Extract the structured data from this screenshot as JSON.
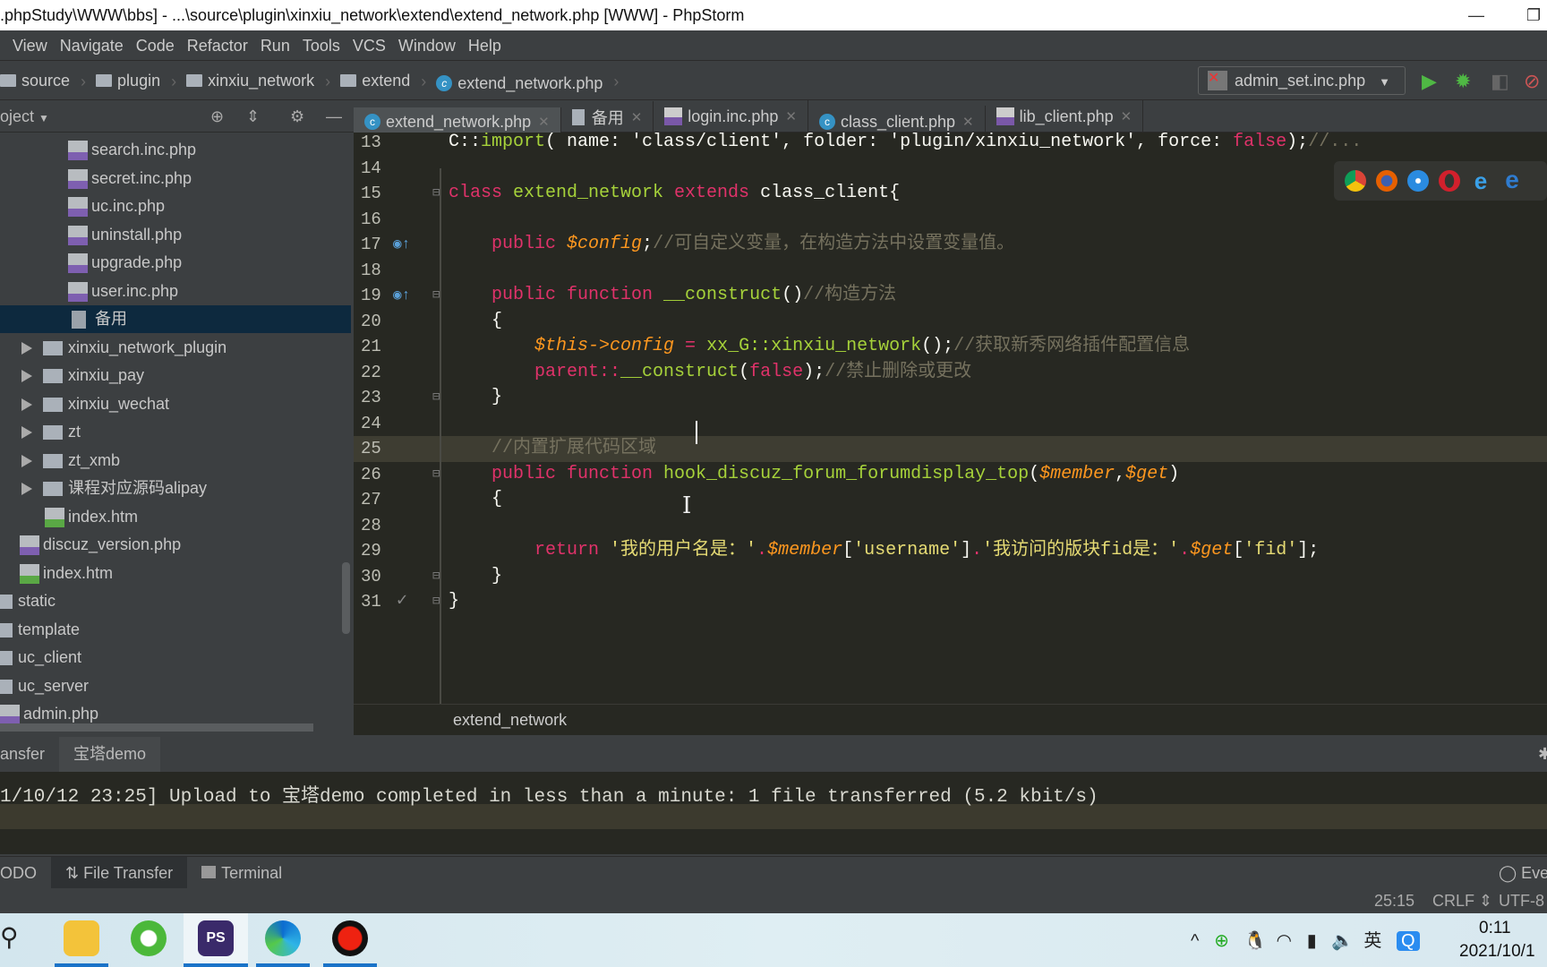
{
  "window": {
    "title": ".phpStudy\\WWW\\bbs] - ...\\source\\plugin\\xinxiu_network\\extend\\extend_network.php [WWW] - PhpStorm",
    "minimize": "—",
    "restore": "❐"
  },
  "menu": [
    "View",
    "Navigate",
    "Code",
    "Refactor",
    "Run",
    "Tools",
    "VCS",
    "Window",
    "Help"
  ],
  "breadcrumb": [
    "source",
    "plugin",
    "xinxiu_network",
    "extend",
    "extend_network.php"
  ],
  "run_config": {
    "label": "admin_set.inc.php"
  },
  "project": {
    "label": "oject"
  },
  "tabs": [
    {
      "label": "extend_network.php",
      "icon": "class",
      "active": true
    },
    {
      "label": "备用",
      "icon": "text"
    },
    {
      "label": "login.inc.php",
      "icon": "php"
    },
    {
      "label": "class_client.php",
      "icon": "class"
    },
    {
      "label": "lib_client.php",
      "icon": "php"
    }
  ],
  "tree": [
    {
      "label": "search.inc.php",
      "type": "php",
      "depth": 3
    },
    {
      "label": "secret.inc.php",
      "type": "php",
      "depth": 3
    },
    {
      "label": "uc.inc.php",
      "type": "php",
      "depth": 3
    },
    {
      "label": "uninstall.php",
      "type": "php",
      "depth": 3
    },
    {
      "label": "upgrade.php",
      "type": "php",
      "depth": 3
    },
    {
      "label": "user.inc.php",
      "type": "php",
      "depth": 3
    },
    {
      "label": "备用",
      "type": "doc",
      "depth": 3,
      "selected": true
    },
    {
      "label": "xinxiu_network_plugin",
      "type": "folder",
      "depth": 2
    },
    {
      "label": "xinxiu_pay",
      "type": "folder",
      "depth": 2
    },
    {
      "label": "xinxiu_wechat",
      "type": "folder",
      "depth": 2
    },
    {
      "label": "zt",
      "type": "folder",
      "depth": 2
    },
    {
      "label": "zt_xmb",
      "type": "folder",
      "depth": 2
    },
    {
      "label": "课程对应源码alipay",
      "type": "folder",
      "depth": 2
    },
    {
      "label": "index.htm",
      "type": "htm",
      "depth": 2
    },
    {
      "label": "discuz_version.php",
      "type": "php",
      "depth": 1
    },
    {
      "label": "index.htm",
      "type": "htm",
      "depth": 1
    },
    {
      "label": "static",
      "type": "rootfolder",
      "depth": 0
    },
    {
      "label": "template",
      "type": "rootfolder",
      "depth": 0
    },
    {
      "label": "uc_client",
      "type": "rootfolder",
      "depth": 0
    },
    {
      "label": "uc_server",
      "type": "rootfolder",
      "depth": 0
    },
    {
      "label": "admin.php",
      "type": "php",
      "depth": 0
    }
  ],
  "code": [
    {
      "n": "13",
      "tokens": [
        [
          "pl",
          "C::"
        ],
        [
          "fn",
          "import"
        ],
        [
          "pl",
          "( name: 'class/client', folder: 'plugin/xinxiu_network', force: "
        ],
        [
          "kw",
          "false"
        ],
        [
          "pl",
          ");"
        ],
        [
          "cm",
          "//..."
        ]
      ]
    },
    {
      "n": "14",
      "tokens": []
    },
    {
      "n": "15",
      "tokens": [
        [
          "kw",
          "class "
        ],
        [
          "fn",
          "extend_network "
        ],
        [
          "kw",
          "extends "
        ],
        [
          "pl",
          "class_client{"
        ]
      ]
    },
    {
      "n": "16",
      "tokens": []
    },
    {
      "n": "17",
      "tokens": [
        [
          "pl",
          "    "
        ],
        [
          "kw",
          "public "
        ],
        [
          "var",
          "$config"
        ],
        [
          "pl",
          ";"
        ],
        [
          "cm",
          "//可自定义变量，在构造方法中设置变量值。"
        ]
      ]
    },
    {
      "n": "18",
      "tokens": []
    },
    {
      "n": "19",
      "tokens": [
        [
          "pl",
          "    "
        ],
        [
          "kw",
          "public function "
        ],
        [
          "fn",
          "__construct"
        ],
        [
          "pl",
          "()"
        ],
        [
          "cm",
          "//构造方法"
        ]
      ]
    },
    {
      "n": "20",
      "tokens": [
        [
          "pl",
          "    {"
        ]
      ]
    },
    {
      "n": "21",
      "tokens": [
        [
          "pl",
          "        "
        ],
        [
          "var",
          "$this->config"
        ],
        [
          "kw",
          " = "
        ],
        [
          "fn",
          "xx_G::xinxiu_network"
        ],
        [
          "pl",
          "();"
        ],
        [
          "cm",
          "//获取新秀网络插件配置信息"
        ]
      ]
    },
    {
      "n": "22",
      "tokens": [
        [
          "pl",
          "        "
        ],
        [
          "kw",
          "parent::"
        ],
        [
          "fn",
          "__construct"
        ],
        [
          "pl",
          "("
        ],
        [
          "kw",
          "false"
        ],
        [
          "pl",
          ");"
        ],
        [
          "cm",
          "//禁止删除或更改"
        ]
      ]
    },
    {
      "n": "23",
      "tokens": [
        [
          "pl",
          "    }"
        ]
      ]
    },
    {
      "n": "24",
      "tokens": []
    },
    {
      "n": "25",
      "tokens": [
        [
          "pl",
          "    "
        ],
        [
          "cm",
          "//内置扩展代码区域"
        ]
      ],
      "current": true
    },
    {
      "n": "26",
      "tokens": [
        [
          "pl",
          "    "
        ],
        [
          "kw",
          "public function "
        ],
        [
          "fn",
          "hook_discuz_forum_forumdisplay_top"
        ],
        [
          "pl",
          "("
        ],
        [
          "var",
          "$member"
        ],
        [
          "pl",
          ","
        ],
        [
          "var",
          "$get"
        ],
        [
          "pl",
          ")"
        ]
      ]
    },
    {
      "n": "27",
      "tokens": [
        [
          "pl",
          "    {"
        ]
      ]
    },
    {
      "n": "28",
      "tokens": []
    },
    {
      "n": "29",
      "tokens": [
        [
          "pl",
          "        "
        ],
        [
          "kw",
          "return "
        ],
        [
          "str",
          "'我的用户名是：'"
        ],
        [
          "kw",
          "."
        ],
        [
          "var",
          "$member"
        ],
        [
          "pl",
          "["
        ],
        [
          "str",
          "'username'"
        ],
        [
          "pl",
          "]"
        ],
        [
          "kw",
          "."
        ],
        [
          "str",
          "'我访问的版块fid是：'"
        ],
        [
          "kw",
          "."
        ],
        [
          "var",
          "$get"
        ],
        [
          "pl",
          "["
        ],
        [
          "str",
          "'fid'"
        ],
        [
          "pl",
          "];"
        ]
      ]
    },
    {
      "n": "30",
      "tokens": [
        [
          "pl",
          "    }"
        ]
      ]
    },
    {
      "n": "31",
      "tokens": [
        [
          "pl",
          "}"
        ]
      ]
    }
  ],
  "editor_breadcrumb": "extend_network",
  "bottom_panel": {
    "tabs": [
      "ansfer",
      "宝塔demo"
    ],
    "log": "1/10/12 23:25] Upload to 宝塔demo completed in less than a minute: 1 file transferred (5.2 kbit/s)"
  },
  "tool_windows": [
    "ODO",
    "File Transfer",
    "Terminal"
  ],
  "event_log": "Eve",
  "status": {
    "position": "25:15",
    "line_sep": "CRLF",
    "encoding": "UTF-8"
  },
  "taskbar": {
    "time": "0:11",
    "date": "2021/10/1",
    "ime": "英"
  },
  "colors": {
    "editor_bg": "#272822",
    "keyword": "#e0326a",
    "function": "#a6d23a",
    "variable": "#fd971f",
    "comment": "#75715e",
    "string": "#e6db74",
    "selection": "#0d293e"
  }
}
